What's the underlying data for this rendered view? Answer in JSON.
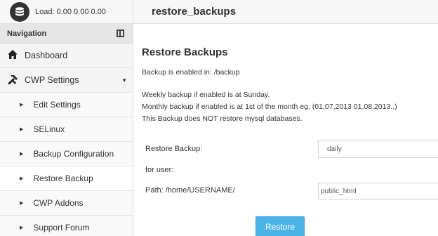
{
  "header": {
    "load_label": "Load: 0.00  0.00  0.00",
    "page_title": "restore_backups"
  },
  "sidebar": {
    "nav_heading": "Navigation",
    "dashboard": "Dashboard",
    "cwp_settings": "CWP Settings",
    "sub_items": [
      "Edit Settings",
      "SELinux",
      "Backup Configuration",
      "Restore Backup",
      "CWP Addons",
      "Support Forum"
    ]
  },
  "main": {
    "title": "Restore Backups",
    "enabled_in": "Backup is enabled in: /backup",
    "weekly": "Weekly backup if enabled is at Sunday.",
    "monthly": "Monthly backup if enabled is at 1st of the month eg. (01,07,2013 01,08,2013..)",
    "no_mysql": "This Backup does NOT restore mysql databases.",
    "restore_backup_label": "Restore Backup:",
    "restore_backup_value": "daily",
    "for_user_label": "for user:",
    "path_label": "Path: /home/USERNAME/",
    "path_value": "public_html",
    "restore_button": "Restore"
  },
  "colors": {
    "accent": "#4bb4e6"
  },
  "icons": [
    "database-icon",
    "collapse-icon",
    "home-icon",
    "tools-icon",
    "caret-down-icon",
    "triangle-right-icon"
  ]
}
